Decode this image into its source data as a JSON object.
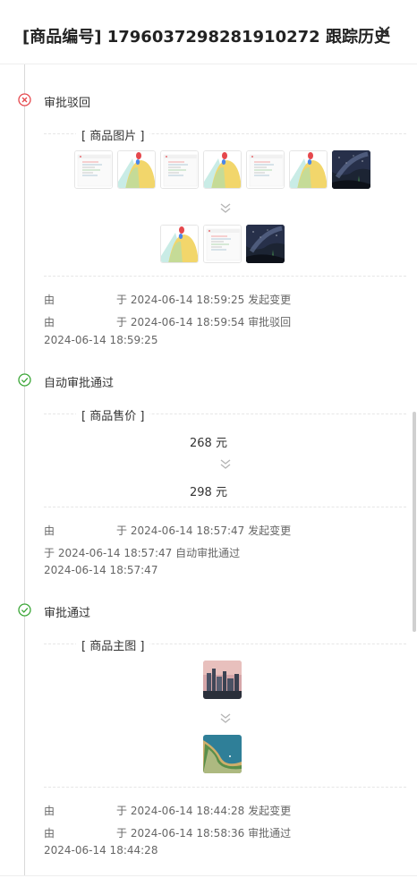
{
  "header": {
    "title": "[商品编号] 1796037298281910272 跟踪历史"
  },
  "nodes": [
    {
      "status": "审批驳回",
      "status_type": "rejected",
      "section_label": "[ 商品图片 ]",
      "logs": [
        {
          "by": "由",
          "text": "于 2024-06-14 18:59:25 发起变更"
        },
        {
          "by": "由",
          "text": "于 2024-06-14 18:59:54 审批驳回"
        }
      ],
      "timestamp": "2024-06-14 18:59:25"
    },
    {
      "status": "自动审批通过",
      "status_type": "approved",
      "section_label": "[ 商品售价 ]",
      "price_before": "268 元",
      "price_after": "298 元",
      "logs": [
        {
          "by": "由",
          "text": "于 2024-06-14 18:57:47 发起变更"
        },
        {
          "by": "",
          "text": "于 2024-06-14 18:57:47 自动审批通过"
        }
      ],
      "timestamp": "2024-06-14 18:57:47"
    },
    {
      "status": "审批通过",
      "status_type": "approved",
      "section_label": "[ 商品主图 ]",
      "logs": [
        {
          "by": "由",
          "text": "于 2024-06-14 18:44:28 发起变更"
        },
        {
          "by": "由",
          "text": "于 2024-06-14 18:58:36 审批通过"
        }
      ],
      "timestamp": "2024-06-14 18:44:28"
    }
  ],
  "colors": {
    "rejected": "#e5484d",
    "approved": "#3aa636",
    "chevron": "#b5b5b5"
  },
  "icons": {
    "close": "close-icon",
    "rejected": "error-circle-icon",
    "approved": "check-circle-icon",
    "chevron": "chevron-double-down-icon"
  }
}
